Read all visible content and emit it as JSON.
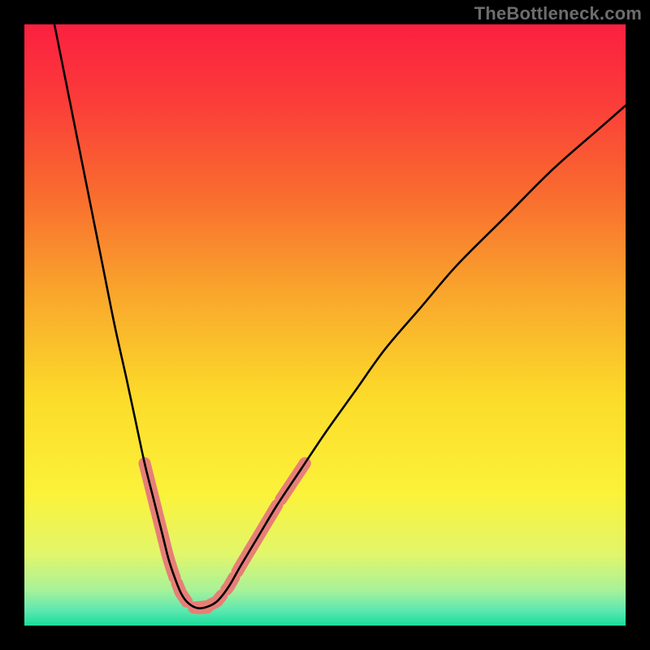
{
  "watermark": "TheBottleneck.com",
  "chart_data": {
    "type": "line",
    "title": "",
    "xlabel": "",
    "ylabel": "",
    "xlim": [
      0,
      100
    ],
    "ylim": [
      0,
      100
    ],
    "series": [
      {
        "name": "curve",
        "x": [
          5,
          7,
          9,
          11,
          13,
          15,
          17,
          18.5,
          20,
          21.5,
          23,
          24,
          25,
          26,
          27,
          28.5,
          30,
          32,
          34,
          36,
          39,
          42,
          46,
          50,
          55,
          60,
          66,
          72,
          80,
          88,
          96,
          100
        ],
        "y": [
          100,
          90,
          80,
          70,
          60,
          50,
          41,
          34,
          27,
          21,
          15,
          11,
          8,
          5.5,
          4,
          3,
          3,
          4,
          6.5,
          10,
          15,
          20,
          26,
          32,
          39,
          46,
          53,
          60,
          68,
          76,
          83,
          86.5
        ]
      }
    ],
    "highlight_segments": [
      {
        "side": "left",
        "y_start": 27,
        "y_end": 8
      },
      {
        "side": "left",
        "y_start": 7,
        "y_end": 4
      },
      {
        "side": "right",
        "y_start": 3,
        "y_end": 5
      },
      {
        "side": "right",
        "y_start": 6,
        "y_end": 8
      },
      {
        "side": "right",
        "y_start": 9,
        "y_end": 20
      },
      {
        "side": "right",
        "y_start": 21,
        "y_end": 27
      },
      {
        "side": "bottom",
        "y_start": 3,
        "y_end": 3
      }
    ],
    "gradient": {
      "stops": [
        {
          "offset": 0.0,
          "color": "#fb2040"
        },
        {
          "offset": 0.12,
          "color": "#fb3a3a"
        },
        {
          "offset": 0.28,
          "color": "#f96b2f"
        },
        {
          "offset": 0.45,
          "color": "#f9a72c"
        },
        {
          "offset": 0.62,
          "color": "#fcdb2a"
        },
        {
          "offset": 0.78,
          "color": "#fbf23a"
        },
        {
          "offset": 0.88,
          "color": "#e2f66a"
        },
        {
          "offset": 0.94,
          "color": "#a9f298"
        },
        {
          "offset": 0.975,
          "color": "#5ce8b0"
        },
        {
          "offset": 1.0,
          "color": "#18dd9a"
        }
      ]
    },
    "highlight_color": "#e77f77"
  }
}
